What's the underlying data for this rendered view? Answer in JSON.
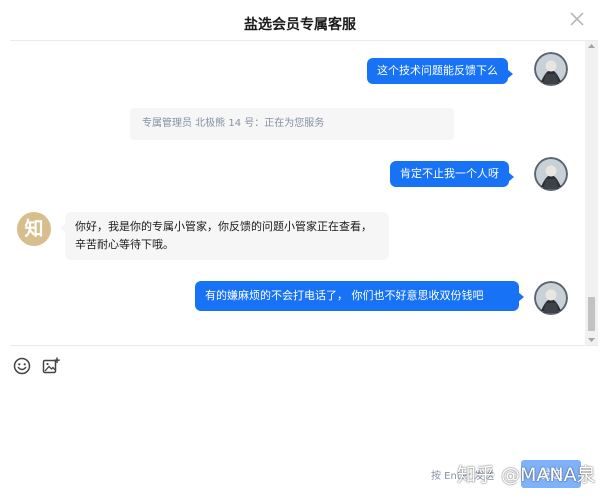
{
  "header": {
    "title": "盐选会员专属客服"
  },
  "messages": [
    {
      "from": "user",
      "text": "这个技术问题能反馈下么"
    },
    {
      "from": "system",
      "text": "专属管理员 北极熊 14 号：正在为您服务"
    },
    {
      "from": "user",
      "text": "肯定不止我一个人呀"
    },
    {
      "from": "agent",
      "avatar_text": "知",
      "text": "你好，我是你的专属小管家，你反馈的问题小管家正在查看，辛苦耐心等待下哦。"
    },
    {
      "from": "user",
      "text": "有的嫌麻烦的不会打电话了， 你们也不好意思收双份钱吧"
    }
  ],
  "toolbar": {
    "emoji_icon": "emoji-icon",
    "image_icon": "image-upload-icon"
  },
  "footer": {
    "hint": "按 Enter 发送",
    "send_label": "发送"
  },
  "watermark": "知乎 @MANA泉",
  "colors": {
    "accent": "#1772f6",
    "send_disabled": "#7fb2fa",
    "bubble_in": "#f6f6f6",
    "agent_avatar": "#d7be8c",
    "muted_text": "#8590a6"
  }
}
